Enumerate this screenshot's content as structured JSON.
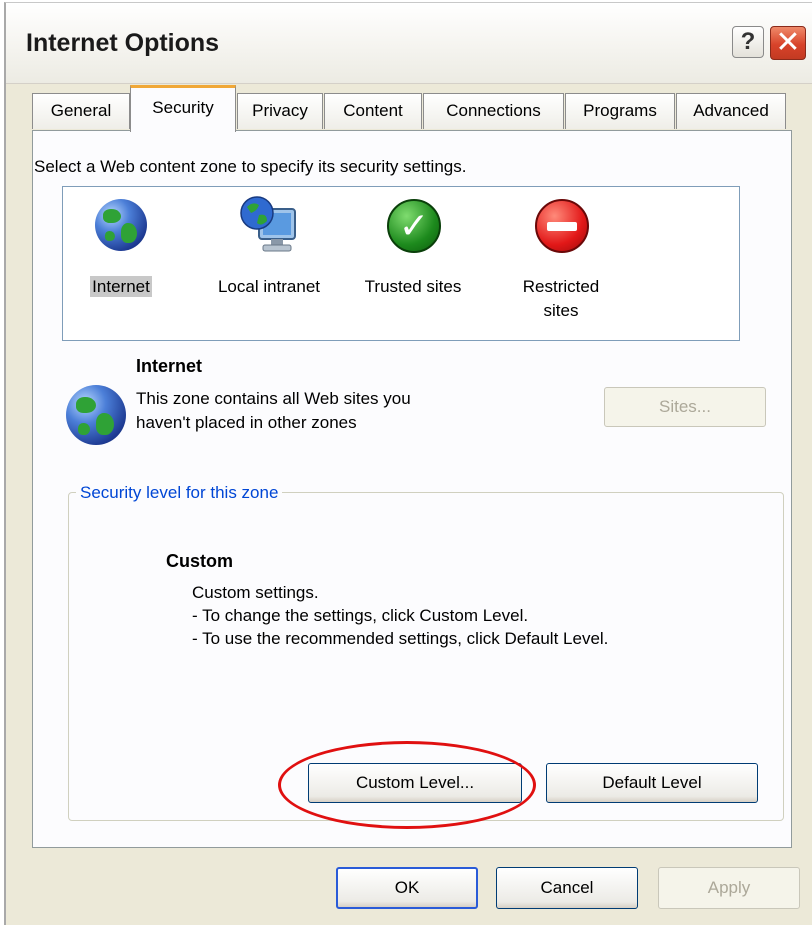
{
  "window": {
    "title": "Internet Options",
    "help_label": "?",
    "close_label": "✕"
  },
  "tabs": [
    {
      "label": "General"
    },
    {
      "label": "Security",
      "active": true
    },
    {
      "label": "Privacy"
    },
    {
      "label": "Content"
    },
    {
      "label": "Connections"
    },
    {
      "label": "Programs"
    },
    {
      "label": "Advanced"
    }
  ],
  "security": {
    "select_zone_text": "Select a Web content zone to specify its security settings.",
    "zones": [
      {
        "label": "Internet",
        "icon": "globe-icon",
        "selected": true
      },
      {
        "label": "Local intranet",
        "icon": "monitor-globe-icon"
      },
      {
        "label": "Trusted sites",
        "icon": "check-icon",
        "check_glyph": "✓"
      },
      {
        "label": "Restricted\nsites",
        "label_line1": "Restricted",
        "label_line2": "sites",
        "icon": "no-entry-icon"
      }
    ],
    "selected_zone": {
      "title": "Internet",
      "description_line1": "This zone contains all Web sites you",
      "description_line2": "haven't placed in other zones",
      "sites_button": "Sites..."
    },
    "level_group": {
      "legend": "Security level for this zone",
      "level_title": "Custom",
      "lines": [
        "Custom settings.",
        "- To change the settings, click Custom Level.",
        "- To use the recommended settings, click Default Level."
      ],
      "custom_level_button": "Custom Level...",
      "default_level_button": "Default Level"
    }
  },
  "footer": {
    "ok": "OK",
    "cancel": "Cancel",
    "apply": "Apply"
  },
  "colors": {
    "dialog_bg": "#ece9d8",
    "active_tab_accent": "#f0a838",
    "legend_text": "#0046d5",
    "annotation_ellipse": "#e01010"
  }
}
